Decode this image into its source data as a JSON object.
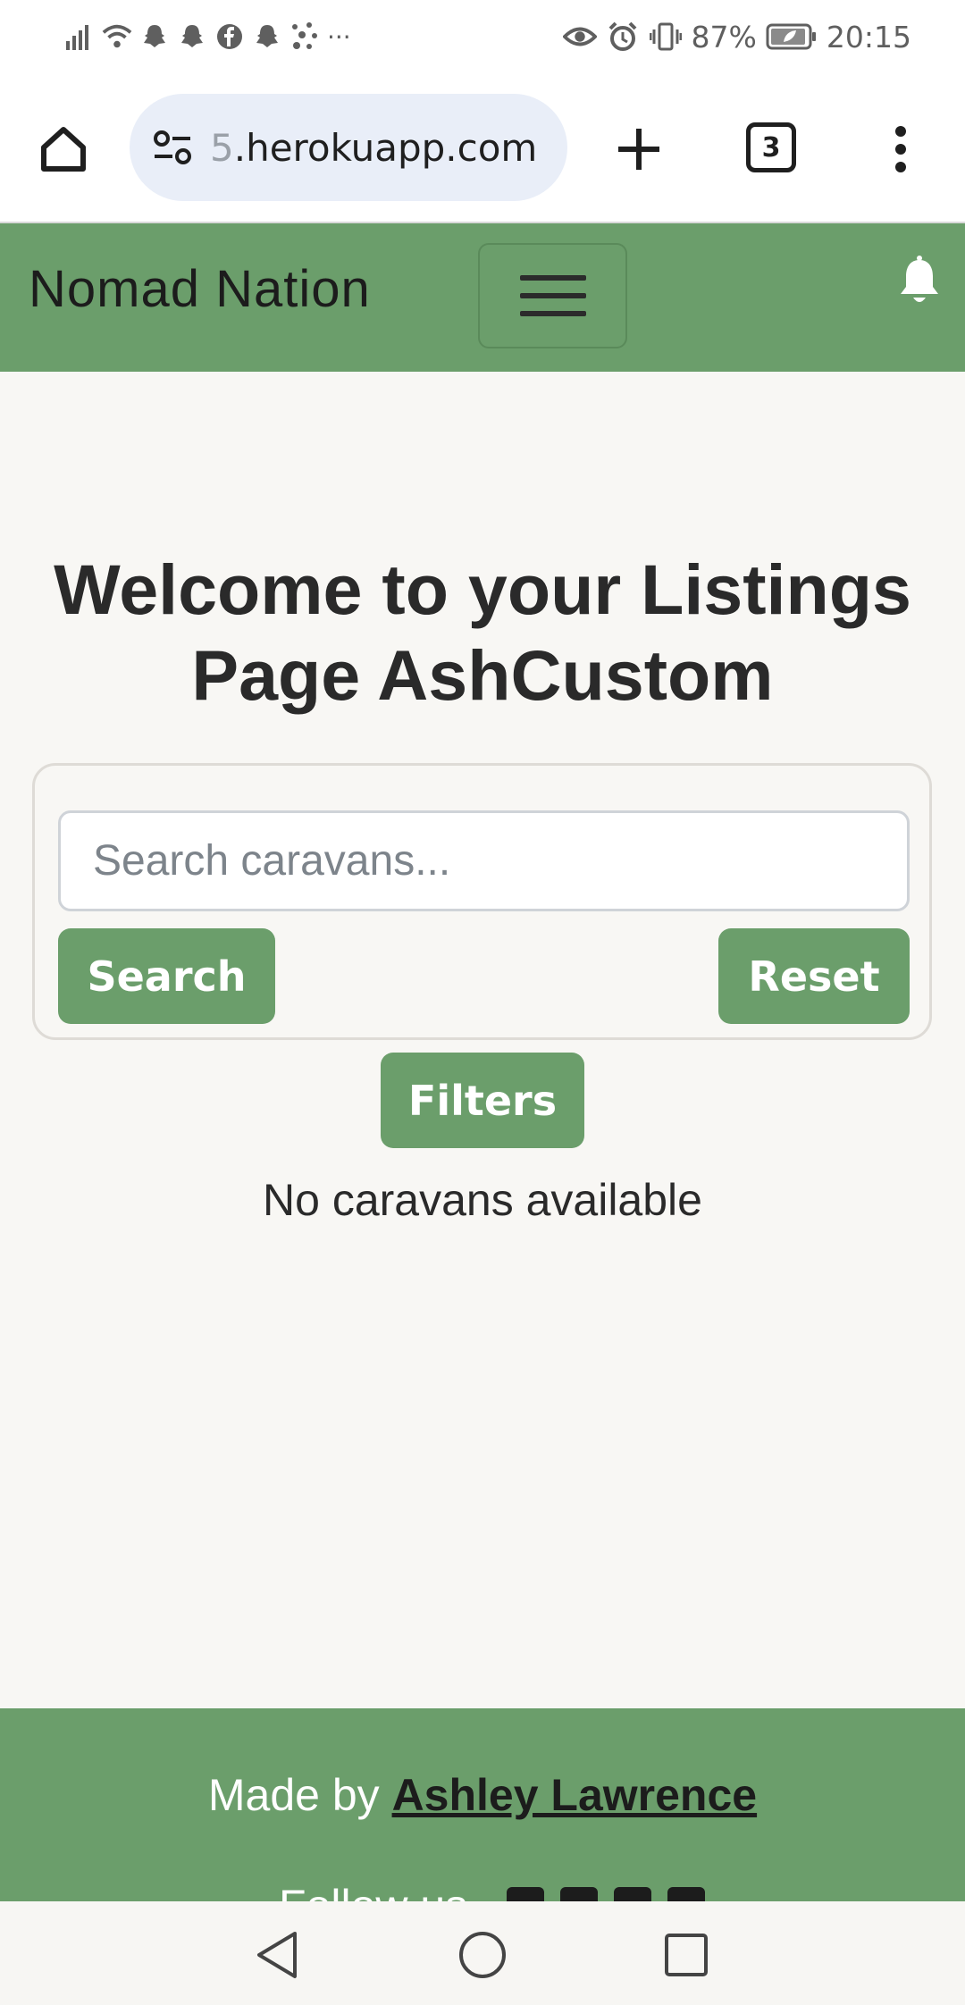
{
  "status_bar": {
    "left_icons": [
      "signal-icon",
      "wifi-icon",
      "snapchat-icon",
      "snapchat-icon",
      "facebook-icon",
      "snapchat-icon",
      "dots-icon"
    ],
    "overflow": "···",
    "battery": "87%",
    "time": "20:15"
  },
  "browser": {
    "url_faded": "5",
    "url": ".herokuapp.com",
    "tab_count": "3"
  },
  "navbar": {
    "brand": "Nomad Nation"
  },
  "main": {
    "title": "Welcome to your Listings Page AshCustom",
    "search": {
      "placeholder": "Search caravans...",
      "value": ""
    },
    "search_label": "Search",
    "reset_label": "Reset",
    "filters_label": "Filters",
    "empty_message": "No caravans available"
  },
  "footer": {
    "made_by_prefix": "Made by ",
    "author": "Ashley Lawrence",
    "follow_text": "Follow us"
  },
  "colors": {
    "brand_green": "#6b9e6b",
    "page_bg": "#f8f7f4",
    "text_dark": "#2a2a2a"
  }
}
